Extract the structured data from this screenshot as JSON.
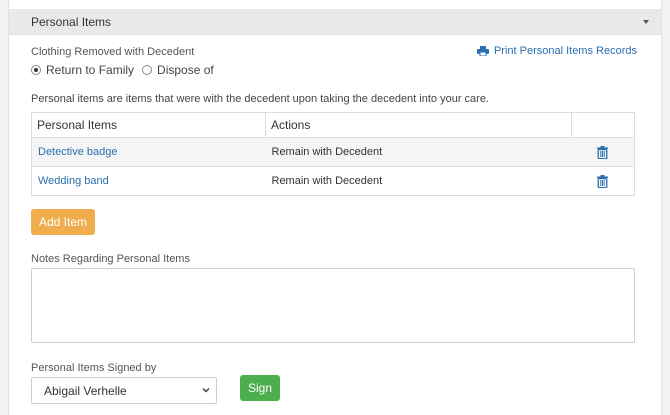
{
  "panel": {
    "title": "Personal Items"
  },
  "clothing": {
    "label": "Clothing Removed with Decedent",
    "options": [
      {
        "label": "Return to Family",
        "selected": true
      },
      {
        "label": "Dispose of",
        "selected": false
      }
    ]
  },
  "print_link": {
    "label": "Print Personal Items Records",
    "icon": "printer-icon"
  },
  "intro_text": "Personal items are items that were with the decedent upon taking the decedent into your care.",
  "table": {
    "headers": [
      "Personal Items",
      "Actions",
      ""
    ],
    "rows": [
      {
        "item": "Detective badge",
        "action": "Remain with Decedent"
      },
      {
        "item": "Wedding band",
        "action": "Remain with Decedent"
      }
    ]
  },
  "add_item_label": "Add Item",
  "notes": {
    "label": "Notes Regarding Personal Items",
    "value": ""
  },
  "signed_by": {
    "label": "Personal Items Signed by",
    "value": "Abigail Verhelle"
  },
  "sign_label": "Sign",
  "colors": {
    "link": "#2a6fb0",
    "add_button": "#f0ad4e",
    "sign_button": "#4cae4c",
    "header_bg": "#e9e9e9"
  }
}
